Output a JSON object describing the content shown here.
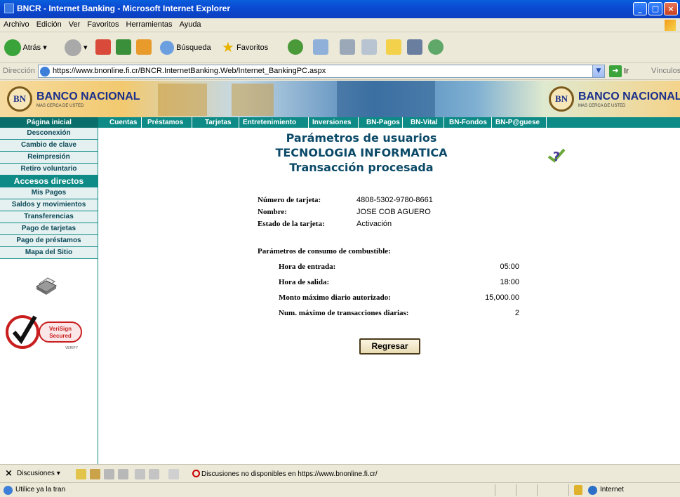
{
  "window": {
    "title": "BNCR - Internet Banking - Microsoft Internet Explorer"
  },
  "menu": [
    "Archivo",
    "Edición",
    "Ver",
    "Favoritos",
    "Herramientas",
    "Ayuda"
  ],
  "toolbar": {
    "back": "Atrás",
    "search": "Búsqueda",
    "favorites": "Favoritos"
  },
  "address": {
    "label": "Dirección",
    "url": "https://www.bnonline.fi.cr/BNCR.InternetBanking.Web/Internet_BankingPC.aspx",
    "go": "Ir",
    "links": "Vínculos"
  },
  "banner": {
    "logo_text": "BANCO NACIONAL",
    "logo_tagline": "MAS CERCA DE USTED",
    "logo_mark": "BN"
  },
  "topnav": {
    "home": "Página inicial",
    "tabs": [
      "Cuentas",
      "Préstamos",
      "Tarjetas",
      "Entretenimiento",
      "Inversiones",
      "BN-Pagos",
      "BN-Vital",
      "BN-Fondos",
      "BN-P@guese"
    ]
  },
  "sidebar": {
    "items_top": [
      "Desconexión",
      "Cambio de clave",
      "Reimpresión",
      "Retiro voluntario"
    ],
    "section_title": "Accesos directos",
    "items_bottom": [
      "Mis Pagos",
      "Saldos y movimientos",
      "Transferencias",
      "Pago de tarjetas",
      "Pago de préstamos",
      "Mapa del Sitio"
    ],
    "verisign_line1": "VeriSign",
    "verisign_line2": "Secured",
    "verisign_verify": "VERIFY"
  },
  "page": {
    "title1": "Parámetros de usuarios",
    "title2": "TECNOLOGIA INFORMATICA",
    "title3": "Transacción procesada",
    "card_label": "Número de tarjeta:",
    "card_value": "4808-5302-9780-8661",
    "name_label": "Nombre:",
    "name_value": "JOSE COB AGUERO",
    "status_label": "Estado de la tarjeta:",
    "status_value": "Activación",
    "fuel_title": "Parámetros de consumo de combustible:",
    "entry_label": "Hora de entrada:",
    "entry_value": "05:00",
    "exit_label": "Hora de salida:",
    "exit_value": "18:00",
    "max_amount_label": "Monto máximo diario autorizado:",
    "max_amount_value": "15,000.00",
    "max_tx_label": "Num. máximo de transacciones diarias:",
    "max_tx_value": "2",
    "back_button": "Regresar"
  },
  "discussion": {
    "label": "Discusiones ▾",
    "message": "Discusiones no disponibles en https://www.bnonline.fi.cr/"
  },
  "status": {
    "text": "Utilice ya la tran",
    "zone": "Internet"
  }
}
